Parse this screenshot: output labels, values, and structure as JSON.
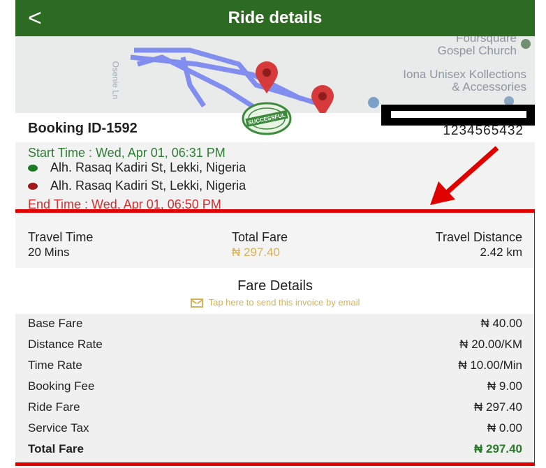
{
  "header": {
    "back_glyph": "<",
    "title": "Ride details"
  },
  "map": {
    "poi_church": "Foursquare\nGospel Church",
    "poi_iona": "Iona Unisex Kollections\n& Accessories",
    "road_label": "Osenie Ln",
    "route_color": "#6f7cf0",
    "pin_color": "#d63a3a"
  },
  "booking": {
    "booking_id": "Booking ID-1592",
    "phone": "1234565432",
    "stamp_text": "SUCCESSFUL"
  },
  "trip": {
    "start_time": "Start Time : Wed, Apr 01, 06:31 PM",
    "pickup_address": "Alh. Rasaq Kadiri St, Lekki, Nigeria",
    "dropoff_address": "Alh. Rasaq Kadiri St, Lekki, Nigeria",
    "end_time": "End Time : Wed, Apr 01, 06:50 PM"
  },
  "summary": {
    "travel_time_label": "Travel Time",
    "travel_time_value": "20 Mins",
    "total_fare_label": "Total Fare",
    "total_fare_value": "₦ 297.40",
    "travel_distance_label": "Travel Distance",
    "travel_distance_value": "2.42 km"
  },
  "fare_details": {
    "title": "Fare Details",
    "email_link": "Tap here to send this invoice by email",
    "rows": [
      {
        "label": "Base Fare",
        "value": "₦ 40.00"
      },
      {
        "label": "Distance Rate",
        "value": "₦ 20.00/KM"
      },
      {
        "label": "Time Rate",
        "value": "₦ 10.00/Min"
      },
      {
        "label": "Booking Fee",
        "value": "₦ 9.00"
      },
      {
        "label": "Ride Fare",
        "value": "₦ 297.40"
      },
      {
        "label": "Service Tax",
        "value": "₦ 0.00"
      },
      {
        "label": "Total Fare",
        "value": "₦ 297.40"
      }
    ]
  },
  "colors": {
    "appbar": "#2e6b22",
    "highlight": "#e00000",
    "accent_gold": "#d7b15a",
    "total_green": "#2a7a2a"
  }
}
